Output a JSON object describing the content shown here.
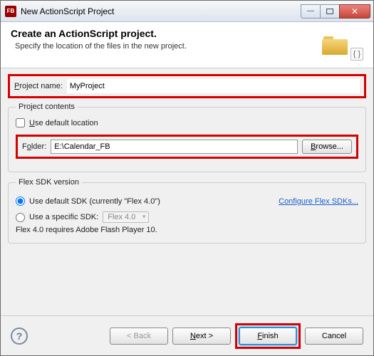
{
  "titlebar": {
    "icon_text": "FB",
    "title": "New ActionScript Project"
  },
  "banner": {
    "title": "Create an ActionScript project.",
    "subtitle": "Specify the location of the files in the new project."
  },
  "projectName": {
    "label": "Project name:",
    "value": "MyProject"
  },
  "contents": {
    "legend": "Project contents",
    "useDefaultLabel": "Use default location",
    "folderLabel": "Folder:",
    "folderValue": "E:\\Calendar_FB",
    "browse": "Browse..."
  },
  "sdk": {
    "legend": "Flex SDK version",
    "useDefault": "Use default SDK (currently \"Flex 4.0\")",
    "useSpecific": "Use a specific SDK:",
    "selected": "Flex 4.0",
    "configure": "Configure Flex SDKs...",
    "requirement": "Flex 4.0 requires Adobe Flash Player 10."
  },
  "footer": {
    "back": "< Back",
    "next": "Next >",
    "finish": "Finish",
    "cancel": "Cancel"
  }
}
